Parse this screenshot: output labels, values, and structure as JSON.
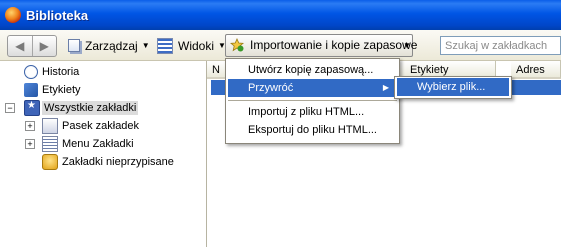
{
  "window": {
    "title": "Biblioteka"
  },
  "toolbar": {
    "back_glyph": "◀",
    "forward_glyph": "▶",
    "manage_label": "Zarządzaj",
    "views_label": "Widoki",
    "import_label": "Importowanie i kopie zapasowe",
    "search_placeholder": "Szukaj w zakładkach"
  },
  "sidebar": {
    "items": [
      {
        "label": "Historia",
        "icon": "clock-icon"
      },
      {
        "label": "Etykiety",
        "icon": "tag-icon"
      },
      {
        "label": "Wszystkie zakładki",
        "icon": "star-icon",
        "selected": true,
        "expanded": true
      },
      {
        "label": "Pasek zakładek",
        "icon": "folder-icon",
        "collapsed": true
      },
      {
        "label": "Menu Zakładki",
        "icon": "menu-folder-icon",
        "collapsed": true
      },
      {
        "label": "Zakładki nieprzypisane",
        "icon": "unfiled-icon"
      }
    ]
  },
  "content": {
    "columns": [
      "N",
      "Etykiety",
      "Adres"
    ]
  },
  "import_menu": {
    "items": [
      {
        "label": "Utwórz kopię zapasową..."
      },
      {
        "label": "Przywróć",
        "highlighted": true,
        "has_submenu": true
      },
      {
        "label": "Importuj z pliku HTML..."
      },
      {
        "label": "Eksportuj do pliku HTML..."
      }
    ]
  },
  "restore_submenu": {
    "items": [
      {
        "label": "Wybierz plik...",
        "highlighted": true
      }
    ]
  },
  "colors": {
    "titlebar": "#0055e5",
    "selection": "#316ac5",
    "toolbar_bg": "#ece9d8"
  }
}
